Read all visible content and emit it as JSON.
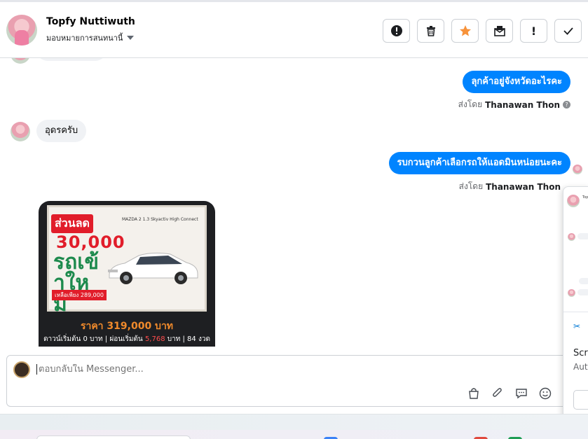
{
  "header": {
    "contact_name": "Topfy Nuttiwuth",
    "assign_label": "มอบหมายการสนทนานี้"
  },
  "toolbar": {
    "spam_icon": "alert-circle-icon",
    "delete_icon": "trash-icon",
    "star_icon": "star-icon",
    "unread_icon": "mail-icon",
    "flag_label": "!",
    "done_icon": "checkmark-icon",
    "star_color": "#f7923a"
  },
  "messages": [
    {
      "direction": "out",
      "text": "ลุกค้าอยู่จังหวัดอะไรคะ"
    },
    {
      "direction": "out_meta",
      "sent_by_prefix": "ส่งโดย",
      "sent_by_name": "Thanawan Thon"
    },
    {
      "direction": "in",
      "text": "อุดรครับ"
    },
    {
      "direction": "out",
      "text": "รบกวนลูกค้าเลือกรถให้แอดมินหน่อยนะคะ"
    },
    {
      "direction": "out_meta",
      "sent_by_prefix": "ส่งโดย",
      "sent_by_name": "Thanawan Thon"
    }
  ],
  "car_card": {
    "promo_discount_label": "ส่วนลด",
    "promo_amount": "30,000",
    "promo_tag": "รถเข้าใหม่",
    "promo_small": "เหลือเพียง 289,000",
    "model_text": "MAZDA 2 1.3 Skyactiv High Connect",
    "price": "ราคา 319,000 บาท",
    "terms_prefix": "ดาวน์เริ่มต้น 0 บาท | ผ่อนเริ่มต้น ",
    "terms_amount": "5,768",
    "terms_suffix": " บาท | 84 งวด"
  },
  "composer": {
    "placeholder": "ตอบกลับใน Messenger...",
    "tools": [
      "bag-icon",
      "paperclip-icon",
      "chat-icon",
      "emoji-icon",
      "baht-icon"
    ]
  },
  "popup": {
    "title_text": "Scre",
    "subtitle_text": "Aut",
    "snip_icon": "snipping-tool-icon"
  },
  "colors": {
    "outgoing_bubble": "#0084ff",
    "incoming_bubble": "#f0f2f5"
  }
}
